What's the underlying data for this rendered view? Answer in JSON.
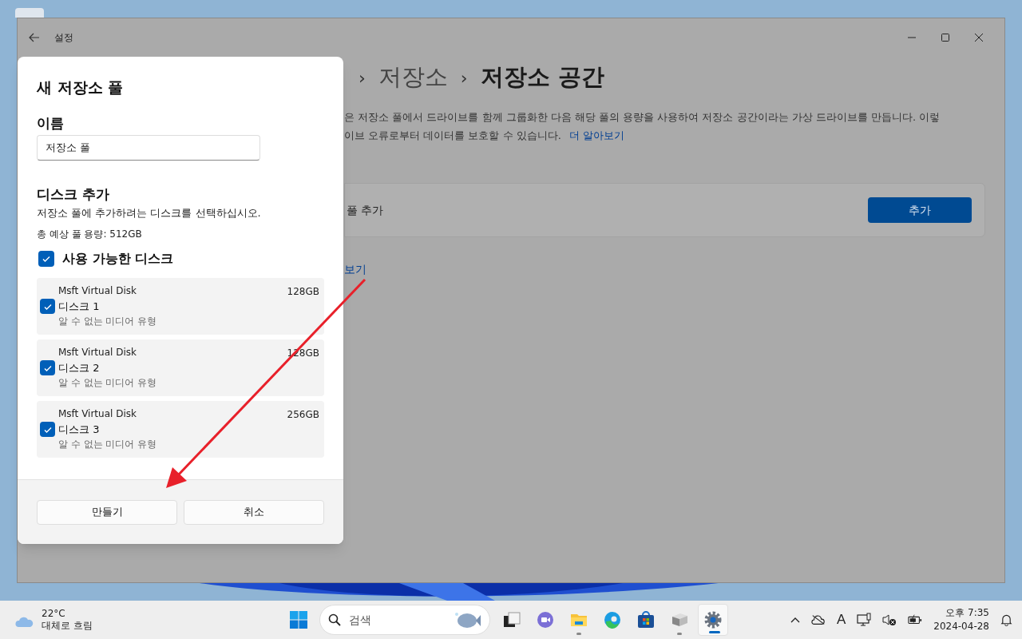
{
  "window": {
    "title": "설정"
  },
  "background": {
    "breadcrumb": [
      "›",
      "저장소",
      "›",
      "저장소 공간"
    ],
    "description_lines": [
      "은 저장소 풀에서 드라이브를 함께 그룹화한 다음 해당 풀의 용량을 사용하여 저장소 공간이라는 가상 드라이브를 만듭니다. 이렇",
      "이브 오류로부터 데이터를 보호할 수 있습니다."
    ],
    "learn_more": "더 알아보기",
    "card_label": "풀 추가",
    "card_button": "추가",
    "link": "보기"
  },
  "dialog": {
    "title": "새 저장소 풀",
    "name_label": "이름",
    "name_value": "저장소 풀",
    "section_title": "디스크 추가",
    "section_hint": "저장소 풀에 추가하려는 디스크를 선택하십시오.",
    "capacity": "총 예상 풀 용량: 512GB",
    "group": {
      "label": "사용 가능한 디스크",
      "checked": true
    },
    "disks": [
      {
        "model": "Msft Virtual Disk",
        "name": "디스크 1",
        "media": "알 수 없는 미디어 유형",
        "size": "128GB",
        "checked": true
      },
      {
        "model": "Msft Virtual Disk",
        "name": "디스크 2",
        "media": "알 수 없는 미디어 유형",
        "size": "128GB",
        "checked": true
      },
      {
        "model": "Msft Virtual Disk",
        "name": "디스크 3",
        "media": "알 수 없는 미디어 유형",
        "size": "256GB",
        "checked": true
      }
    ],
    "buttons": [
      "만들기",
      "취소"
    ]
  },
  "taskbar": {
    "weather": {
      "temp": "22°C",
      "condition": "대체로 흐림"
    },
    "search": {
      "placeholder": "검색"
    },
    "apps": [
      {
        "kind": "taskview",
        "running": false,
        "selected": false
      },
      {
        "kind": "meet",
        "running": false,
        "selected": false
      },
      {
        "kind": "folder",
        "running": true,
        "selected": false
      },
      {
        "kind": "edge",
        "running": false,
        "selected": false
      },
      {
        "kind": "store",
        "running": false,
        "selected": false
      },
      {
        "kind": "drive",
        "running": true,
        "selected": false
      },
      {
        "kind": "settings",
        "running": true,
        "selected": true
      }
    ],
    "ime": "A",
    "time": "오후 7:35",
    "date": "2024-04-28"
  }
}
